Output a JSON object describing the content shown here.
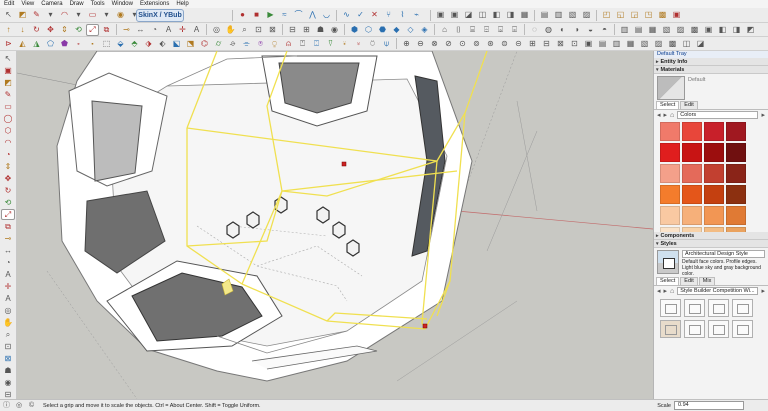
{
  "menu": [
    "Edit",
    "View",
    "Camera",
    "Draw",
    "Tools",
    "Window",
    "Extensions",
    "Help"
  ],
  "extension_badge": "SkinX / YBub",
  "tray": {
    "title": "Default Tray",
    "entity_info": "Entity Info",
    "materials": {
      "header": "Materials",
      "current_name": "Default",
      "tabs": [
        "Select",
        "Edit"
      ],
      "library": "Colors",
      "swatches": [
        "#f07a6a",
        "#e8463a",
        "#c8202a",
        "#a01820",
        "#e01e1e",
        "#c81414",
        "#9c0e0e",
        "#701010",
        "#f4a08a",
        "#e46a5a",
        "#c24030",
        "#8a2418",
        "#f47c2c",
        "#e4561a",
        "#c44010",
        "#8c3010",
        "#f9c9a2",
        "#f6b07a",
        "#f29654",
        "#e07a34",
        "#fbe3c9",
        "#f8d2a8",
        "#f3bc84",
        "#eaa25e"
      ]
    },
    "components": "Components",
    "styles": {
      "header": "Styles",
      "style_name": "Architectural Design Style",
      "style_desc": "Default face colors. Profile edges. Light blue sky and gray background color.",
      "tabs": [
        "Select",
        "Edit",
        "Mix"
      ],
      "collection": "Style Builder Competition Wi..."
    }
  },
  "status": {
    "message": "Select a grip and move it to scale the objects. Ctrl = About Center. Shift = Toggle Uniform.",
    "vcb_label": "Scale",
    "vcb_value": "0.94"
  },
  "colors": {
    "selection_yellow": "#f0e050",
    "grip_red": "#cc2222",
    "viewport_bg": "#c8c8c3"
  }
}
